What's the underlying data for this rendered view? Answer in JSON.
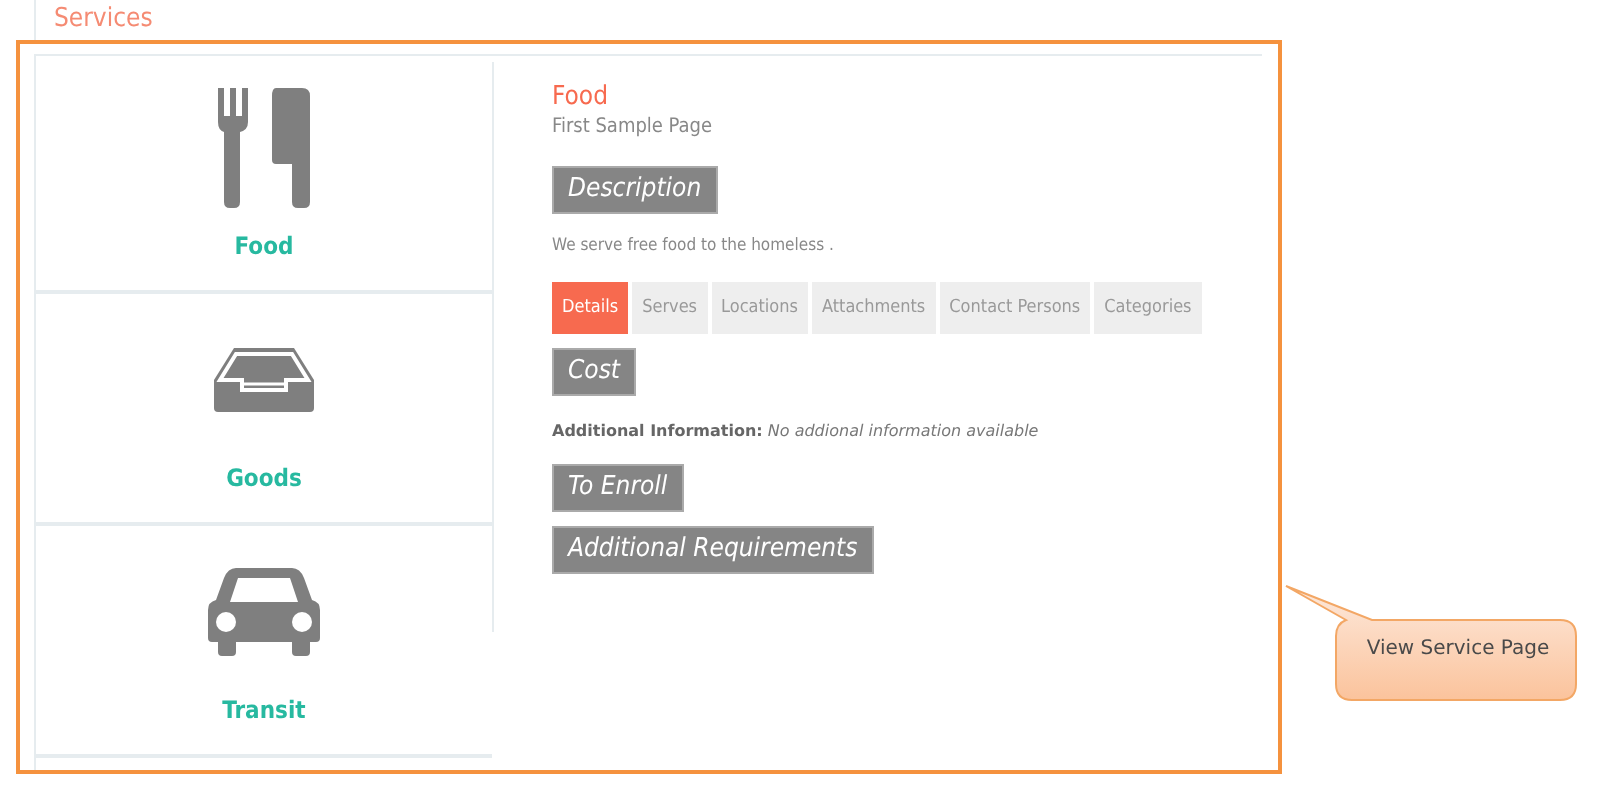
{
  "header": {
    "title": "Services"
  },
  "services": [
    {
      "label": "Food",
      "kind": "cutlery"
    },
    {
      "label": "Goods",
      "kind": "tray"
    },
    {
      "label": "Transit",
      "kind": "car"
    }
  ],
  "detail": {
    "title": "Food",
    "subtitle": "First Sample Page",
    "sections": [
      {
        "kind": "heading",
        "text": "Description"
      },
      {
        "kind": "paragraph",
        "text": "We serve free food to the homeless ."
      },
      {
        "kind": "tabs",
        "tabs": [
          {
            "label": "Details",
            "selected": true
          },
          {
            "label": "Serves",
            "selected": false
          },
          {
            "label": "Locations",
            "selected": false
          },
          {
            "label": "Attachments",
            "selected": false
          },
          {
            "label": "Contact Persons",
            "selected": false
          },
          {
            "label": "Categories",
            "selected": false
          }
        ]
      },
      {
        "kind": "heading",
        "text": "Cost"
      },
      {
        "kind": "info",
        "text": "**Additional Information:** *No addional information available*"
      },
      {
        "kind": "heading",
        "text": "To Enroll"
      },
      {
        "kind": "heading",
        "text": "Additional Requirements"
      }
    ]
  },
  "callout": {
    "text": "View Service Page"
  }
}
